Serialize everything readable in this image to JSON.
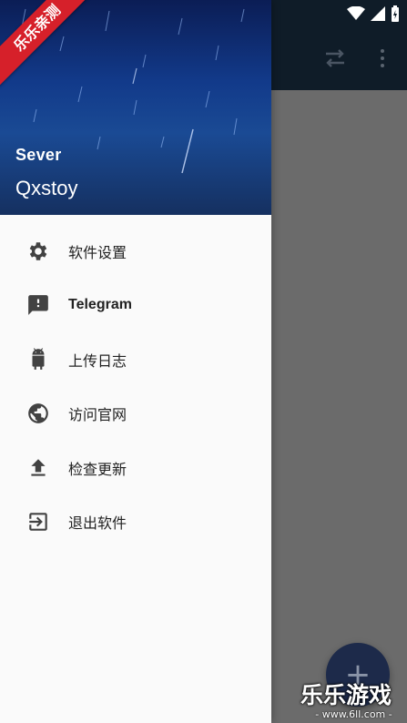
{
  "drawer": {
    "header": {
      "subtitle": "Sever",
      "title": "Qxstoy"
    },
    "items": [
      {
        "label": "软件设置",
        "icon": "gear-icon"
      },
      {
        "label": "Telegram",
        "icon": "chat-alert-icon"
      },
      {
        "label": "上传日志",
        "icon": "android-icon"
      },
      {
        "label": "访问官网",
        "icon": "globe-icon"
      },
      {
        "label": "检查更新",
        "icon": "upload-icon"
      },
      {
        "label": "退出软件",
        "icon": "exit-icon"
      }
    ]
  },
  "app_bar": {
    "actions": [
      "swap-icon",
      "more-vert-icon"
    ]
  },
  "fab": {
    "icon": "plus-icon",
    "label": "+"
  },
  "watermark": {
    "ribbon": "乐乐亲测",
    "brand": "乐乐游戏",
    "url": "- www.6ll.com -"
  },
  "colors": {
    "drawer_bg": "#fafafa",
    "header_blue": "#123a8a",
    "app_bar": "#0f1c28",
    "scrim": "#6b6b6b",
    "fab": "#1d2a4a",
    "ribbon": "#d6202a"
  }
}
